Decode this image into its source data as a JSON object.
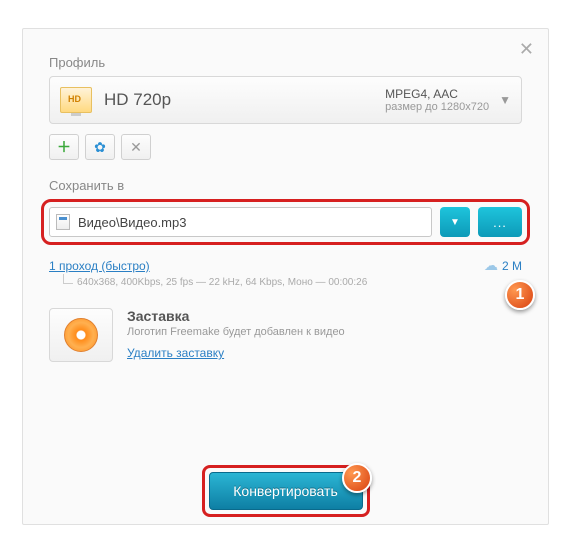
{
  "labels": {
    "profile": "Профиль",
    "save_to": "Сохранить в"
  },
  "profile": {
    "name": "HD 720p",
    "codec": "MPEG4, AAC",
    "size": "размер до 1280x720"
  },
  "save_path": "Видео\\Видео.mp3",
  "browse_label": "...",
  "pass": {
    "link": "1 проход (быстро)",
    "details": "640x368, 400Kbps, 25 fps — 22 kHz, 64 Kbps, Моно — 00:00:26",
    "right_text": "2 М"
  },
  "splash": {
    "title": "Заставка",
    "desc": "Логотип Freemake будет добавлен к видео",
    "remove": "Удалить заставку"
  },
  "convert": "Конвертировать",
  "markers": {
    "one": "1",
    "two": "2"
  }
}
